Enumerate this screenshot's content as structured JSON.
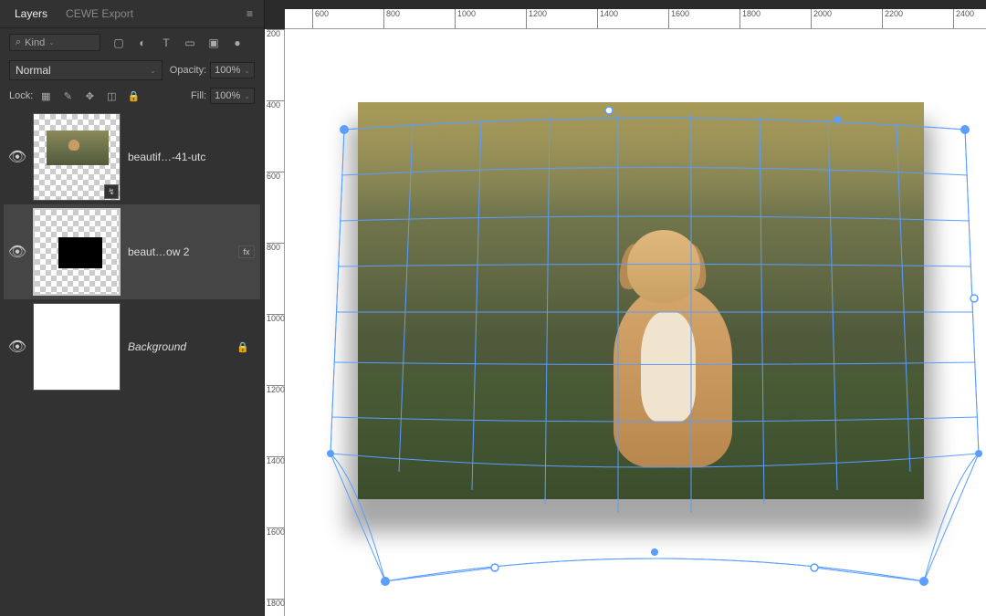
{
  "panel": {
    "tabs": {
      "layers": "Layers",
      "cewe": "CEWE Export"
    },
    "filter_prefix": "Kind",
    "blend_mode": "Normal",
    "opacity_label": "Opacity:",
    "opacity_value": "100%",
    "lock_label": "Lock:",
    "fill_label": "Fill:",
    "fill_value": "100%"
  },
  "layers": [
    {
      "name": "beautif…-41-utc",
      "type": "smart"
    },
    {
      "name": "beaut…ow 2",
      "type": "fx"
    },
    {
      "name": "Background",
      "type": "bg"
    }
  ],
  "ruler_h": [
    "600",
    "800",
    "1000",
    "1200",
    "1400",
    "1600",
    "1800",
    "2000",
    "2200",
    "2400"
  ],
  "ruler_v": [
    "200",
    "400",
    "600",
    "800",
    "1000",
    "1200",
    "1400",
    "1600",
    "1800"
  ],
  "icons": {
    "search": "⌕",
    "image": "▢",
    "adjust": "◐",
    "text": "T",
    "shape": "▭",
    "smart": "▣",
    "dot": "●",
    "menu": "≡",
    "dd": "⌄",
    "eye": "👁",
    "lock": "🔒",
    "px": "▦",
    "brush": "✎",
    "move": "✥",
    "crop": "◫",
    "so": "↯"
  }
}
